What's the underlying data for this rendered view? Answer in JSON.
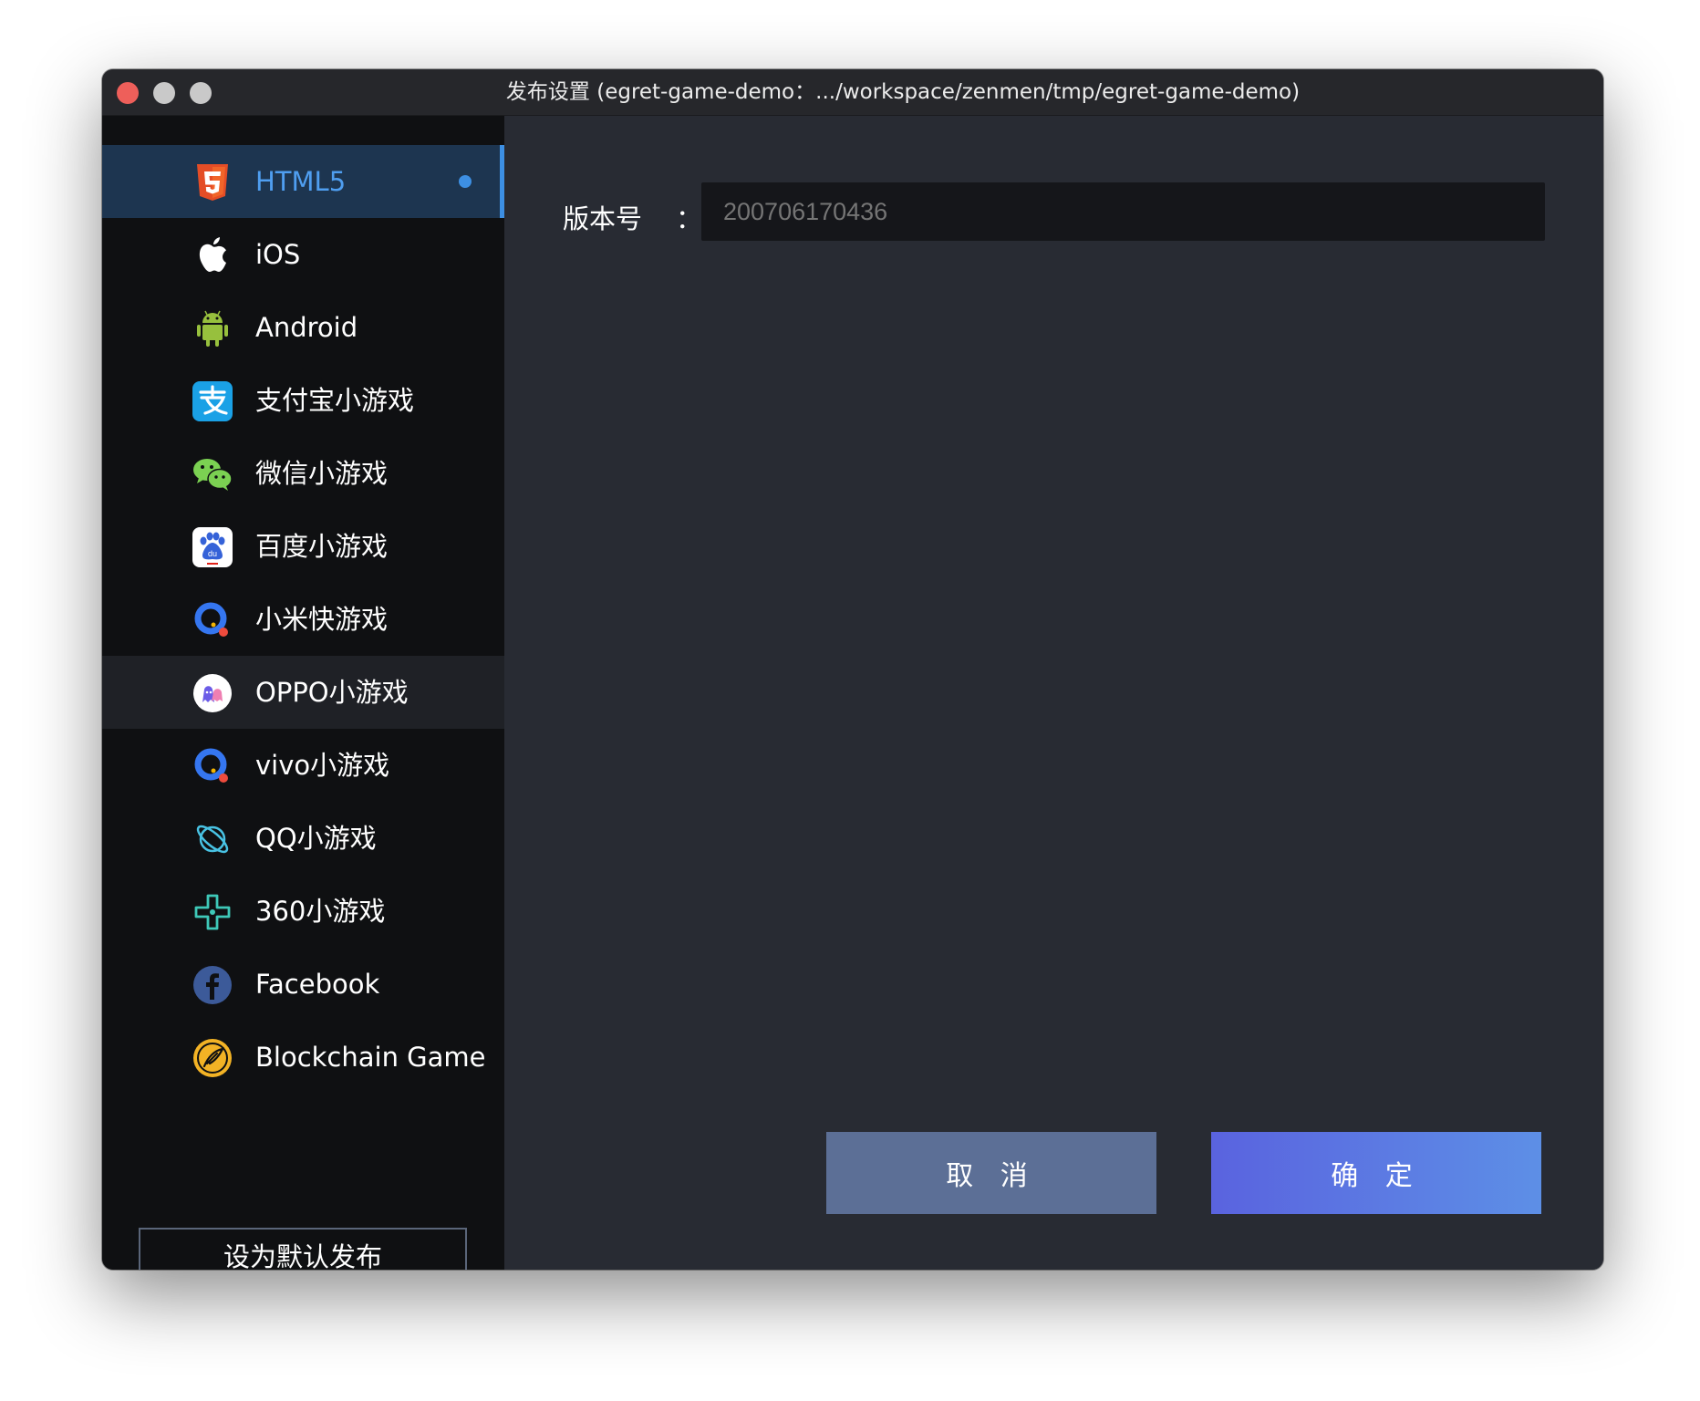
{
  "window": {
    "title": "发布设置 (egret-game-demo：.../workspace/zenmen/tmp/egret-game-demo)"
  },
  "sidebar": {
    "items": [
      {
        "label": "HTML5",
        "icon": "html5-icon",
        "active": true
      },
      {
        "label": "iOS",
        "icon": "apple-icon"
      },
      {
        "label": "Android",
        "icon": "android-icon"
      },
      {
        "label": "支付宝小游戏",
        "icon": "alipay-icon"
      },
      {
        "label": "微信小游戏",
        "icon": "wechat-icon"
      },
      {
        "label": "百度小游戏",
        "icon": "baidu-icon"
      },
      {
        "label": "小米快游戏",
        "icon": "quickgame-icon"
      },
      {
        "label": "OPPO小游戏",
        "icon": "oppo-icon",
        "hover": true
      },
      {
        "label": "vivo小游戏",
        "icon": "quickgame-icon"
      },
      {
        "label": "QQ小游戏",
        "icon": "qq-planet-icon"
      },
      {
        "label": "360小游戏",
        "icon": "360-icon"
      },
      {
        "label": "Facebook",
        "icon": "facebook-icon"
      },
      {
        "label": "Blockchain Game",
        "icon": "blockchain-icon"
      }
    ],
    "default_button": "设为默认发布"
  },
  "form": {
    "version_label": "版本号",
    "colon": "：",
    "version_placeholder": "200706170436"
  },
  "buttons": {
    "cancel": "取 消",
    "ok": "确 定"
  },
  "colors": {
    "accent": "#3d8fe3",
    "sidebar_bg": "#0f1012",
    "main_bg": "#282b33",
    "cancel_bg": "#5c6f96",
    "ok_bg": "#5a63df"
  }
}
